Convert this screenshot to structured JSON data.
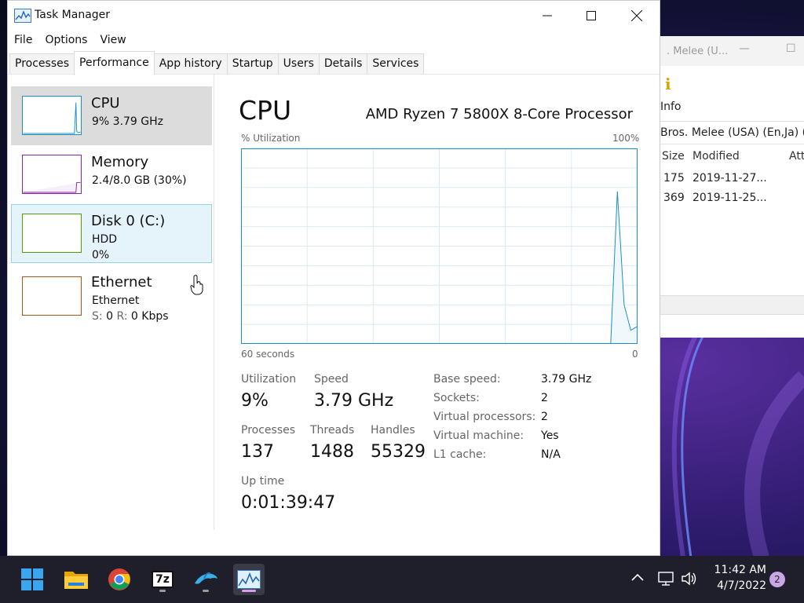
{
  "background_window": {
    "title": "Bros. Melee (U...",
    "title_suffix": ". Melee (U...",
    "toolbar_label": "Info",
    "path": "Bros. Melee (USA) (En,Ja) (R",
    "columns": [
      "Size",
      "Modified",
      "Att"
    ],
    "rows": [
      {
        "size": "175",
        "modified": "2019-11-27..."
      },
      {
        "size": "369",
        "modified": "2019-11-25..."
      }
    ]
  },
  "task_manager": {
    "title": "Task Manager",
    "menu": [
      "File",
      "Options",
      "View"
    ],
    "tabs": [
      "Processes",
      "Performance",
      "App history",
      "Startup",
      "Users",
      "Details",
      "Services"
    ],
    "active_tab": "Performance",
    "sidebar": [
      {
        "name": "CPU",
        "line1": "9%  3.79 GHz",
        "line2": "",
        "color": "#1a8fc9"
      },
      {
        "name": "Memory",
        "line1": "2.4/8.0 GB (30%)",
        "line2": "",
        "color": "#8b23a8"
      },
      {
        "name": "Disk 0 (C:)",
        "line1": "HDD",
        "line2": "0%",
        "color": "#4da000"
      },
      {
        "name": "Ethernet",
        "line1": "Ethernet",
        "line2_label_s": "S:",
        "line2_val_s": "0",
        "line2_label_r": "R:",
        "line2_val_r": "0 Kbps",
        "color": "#a7541a"
      }
    ],
    "panel": {
      "title": "CPU",
      "processor": "AMD Ryzen 7 5800X 8-Core Processor",
      "graph_label": "% Utilization",
      "graph_max": "100%",
      "graph_time_left": "60 seconds",
      "graph_time_right": "0",
      "stats": {
        "utilization_label": "Utilization",
        "utilization": "9%",
        "speed_label": "Speed",
        "speed": "3.79 GHz",
        "processes_label": "Processes",
        "processes": "137",
        "threads_label": "Threads",
        "threads": "1488",
        "handles_label": "Handles",
        "handles": "55329",
        "uptime_label": "Up time",
        "uptime": "0:01:39:47"
      },
      "details": [
        {
          "label": "Base speed:",
          "value": "3.79 GHz"
        },
        {
          "label": "Sockets:",
          "value": "2"
        },
        {
          "label": "Virtual processors:",
          "value": "2"
        },
        {
          "label": "Virtual machine:",
          "value": "Yes"
        },
        {
          "label": "L1 cache:",
          "value": "N/A"
        }
      ],
      "utilization_series": [
        0,
        0,
        0,
        0,
        0,
        0,
        0,
        0,
        0,
        0,
        0,
        0,
        0,
        0,
        0,
        0,
        0,
        0,
        0,
        0,
        0,
        0,
        0,
        0,
        0,
        0,
        0,
        0,
        0,
        0,
        0,
        0,
        0,
        0,
        0,
        0,
        0,
        0,
        0,
        0,
        0,
        0,
        0,
        0,
        0,
        0,
        0,
        0,
        0,
        0,
        0,
        0,
        0,
        0,
        0,
        0,
        78,
        20,
        7,
        9
      ]
    }
  },
  "taskbar": {
    "apps": [
      "start-icon",
      "file-explorer-icon",
      "chrome-icon",
      "7zip-icon",
      "dolphin-icon",
      "task-manager-icon"
    ],
    "sevenzip_label": "7z",
    "time": "11:42 AM",
    "date": "4/7/2022",
    "notifications": "2"
  },
  "colors": {
    "cpu_line": "#1a8fc9",
    "cpu_fill": "#f1f8fc",
    "grid": "#d9eaf4",
    "graph_border": "#1a8fc9"
  }
}
